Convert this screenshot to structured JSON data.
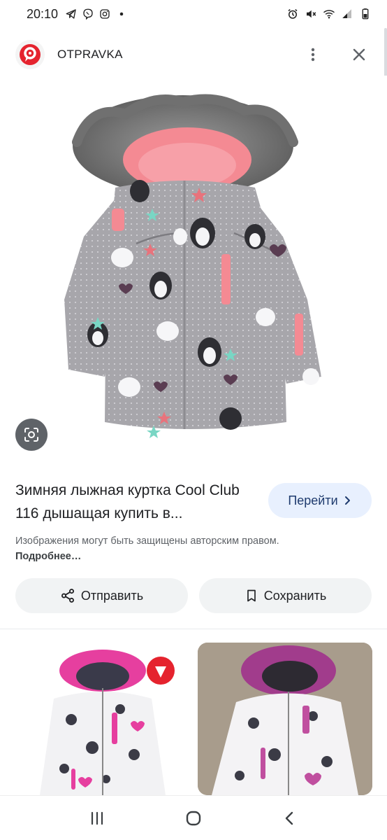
{
  "status_bar": {
    "time": "20:10",
    "left_icons": [
      "telegram-icon",
      "viber-icon",
      "instagram-icon",
      "dot-icon"
    ],
    "right_icons": [
      "alarm-icon",
      "mute-icon",
      "wifi-icon",
      "signal-icon",
      "battery-icon"
    ]
  },
  "header": {
    "site_name": "OTPRAVKA",
    "logo_icon": "otpravka-logo-icon",
    "menu_icon": "more-vert-icon",
    "close_icon": "close-icon"
  },
  "result": {
    "title": "Зимняя лыжная куртка Cool Club 116 дышащая купить в...",
    "goto_label": "Перейти",
    "copyright_text": "Изображения могут быть защищены авторским правом.",
    "more_label": "Подробнее…"
  },
  "actions": {
    "share_label": "Отправить",
    "save_label": "Сохранить"
  },
  "colors": {
    "accent_bg": "#e8f0fe",
    "accent_text": "#1f3b6e",
    "button_bg": "#f1f3f4",
    "logo_red": "#e5232e"
  }
}
